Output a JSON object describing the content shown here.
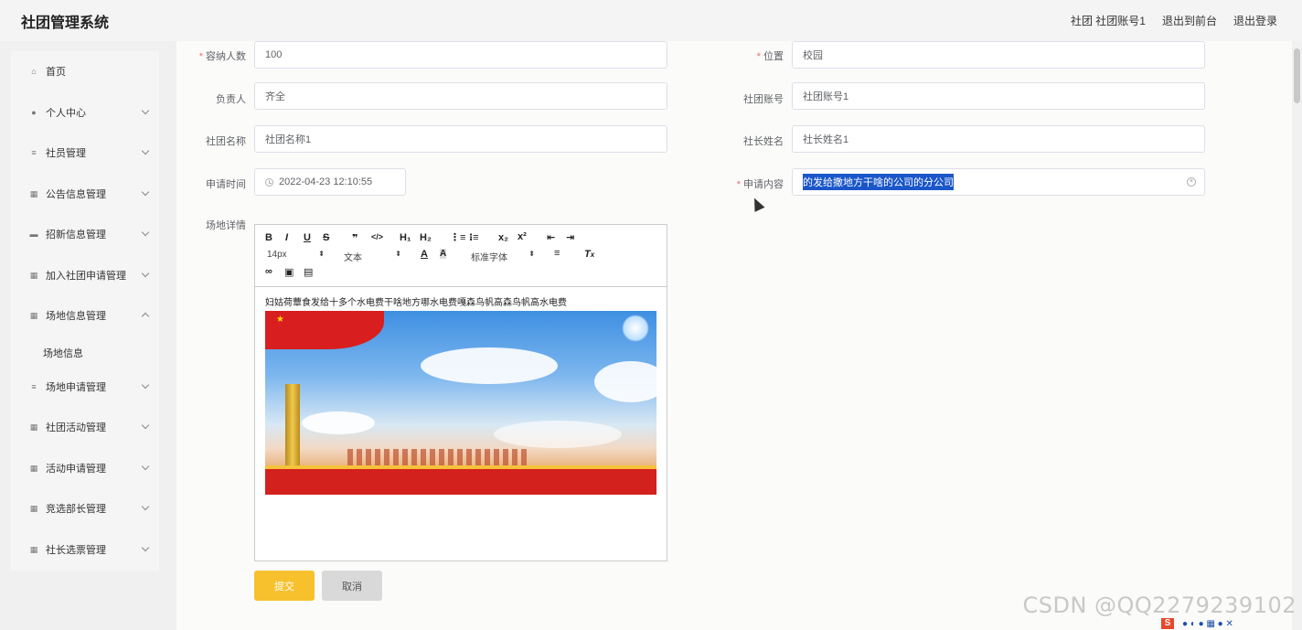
{
  "header": {
    "title": "社团管理系统",
    "account": "社团 社团账号1",
    "to_front": "退出到前台",
    "logout": "退出登录"
  },
  "sidebar": {
    "items": [
      {
        "label": "首页",
        "icon": "home-icon"
      },
      {
        "label": "个人中心",
        "icon": "user-icon"
      },
      {
        "label": "社员管理",
        "icon": "sliders-icon"
      },
      {
        "label": "公告信息管理",
        "icon": "grid-icon"
      },
      {
        "label": "招新信息管理",
        "icon": "briefcase-icon"
      },
      {
        "label": "加入社团申请管理",
        "icon": "grid-icon"
      },
      {
        "label": "场地信息管理",
        "icon": "grid-icon"
      },
      {
        "label": "场地申请管理",
        "icon": "list-icon"
      },
      {
        "label": "社团活动管理",
        "icon": "grid-icon"
      },
      {
        "label": "活动申请管理",
        "icon": "grid-icon"
      },
      {
        "label": "竞选部长管理",
        "icon": "grid-icon"
      },
      {
        "label": "社长选票管理",
        "icon": "grid-icon"
      }
    ],
    "sub_item": "场地信息"
  },
  "form": {
    "capacity_label": "容纳人数",
    "capacity_value": "100",
    "location_label": "位置",
    "location_value": "校园",
    "manager_label": "负责人",
    "manager_value": "齐全",
    "club_account_label": "社团账号",
    "club_account_value": "社团账号1",
    "club_name_label": "社团名称",
    "club_name_value": "社团名称1",
    "president_label": "社长姓名",
    "president_value": "社长姓名1",
    "apply_time_label": "申请时间",
    "apply_time_value": "2022-04-23 12:10:55",
    "apply_content_label": "申请内容",
    "apply_content_value": "的发给撒地方干啥的公司的分公司",
    "venue_detail_label": "场地详情"
  },
  "editor": {
    "font_size": "14px",
    "text_type": "文本",
    "font_family": "标准字体",
    "content_text": "妇姑荷蕈食发给十多个水电费干啥地方哪水电费嘎森鸟帆高森鸟帆高水电费"
  },
  "buttons": {
    "submit": "提交",
    "cancel": "取消"
  },
  "watermark": "CSDN @QQ2279239102",
  "colors": {
    "primary": "#f7c12d",
    "selection": "#1a56c9",
    "required": "#f56c6c"
  }
}
